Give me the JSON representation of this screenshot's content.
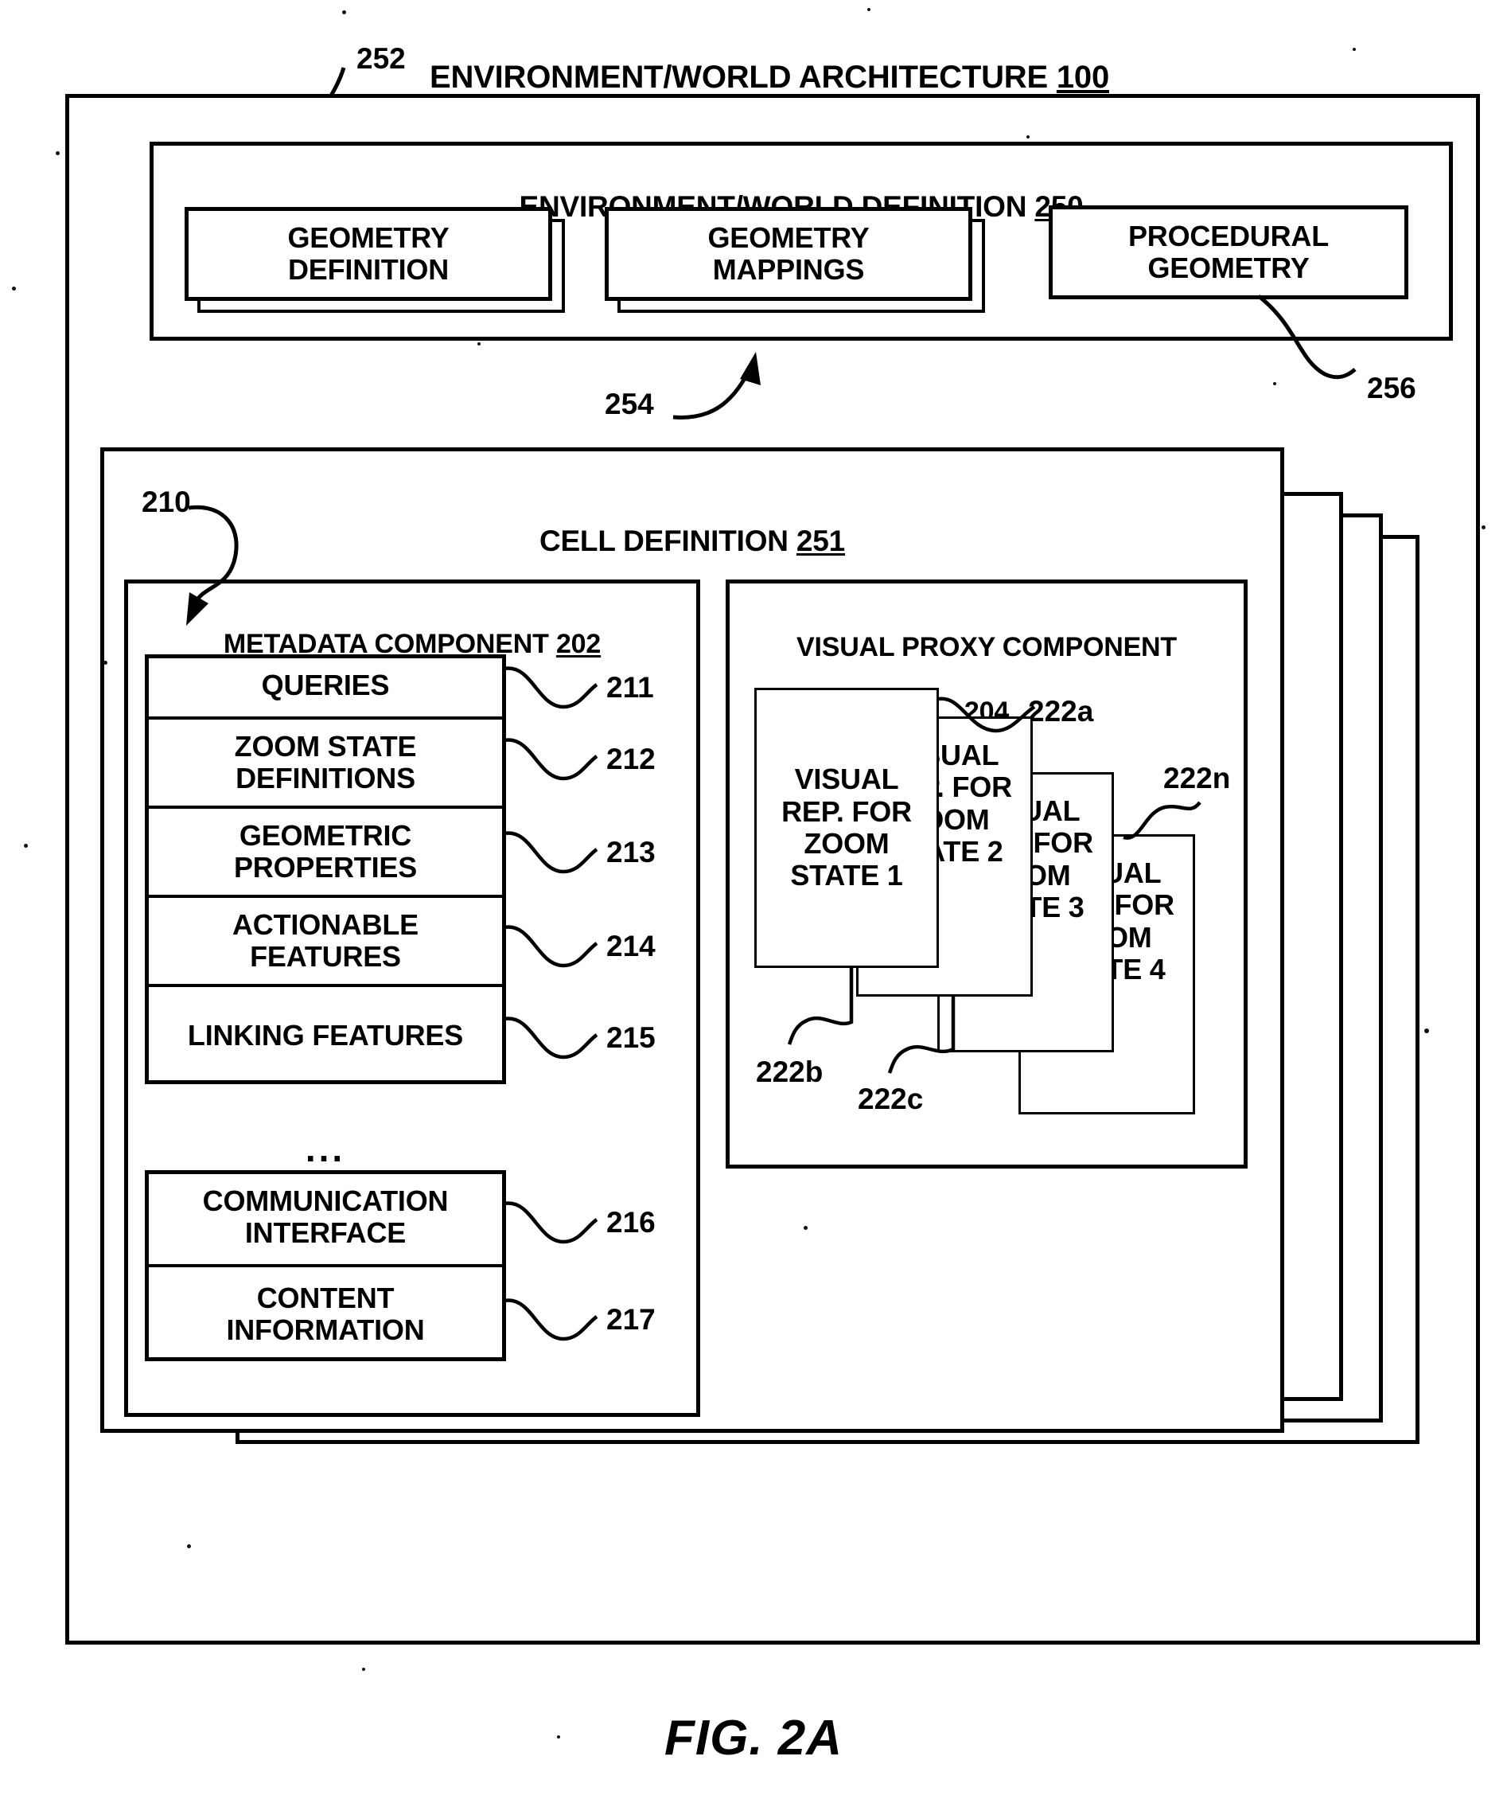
{
  "figure": {
    "caption": "FIG. 2A"
  },
  "architecture": {
    "title": "ENVIRONMENT/WORLD ARCHITECTURE",
    "title_ref": "100",
    "callout_ref": "252"
  },
  "world_definition": {
    "title": "ENVIRONMENT/WORLD DEFINITION",
    "title_ref": "250",
    "boxes": [
      {
        "label": "GEOMETRY\nDEFINITION",
        "stacked": true,
        "ref": ""
      },
      {
        "label": "GEOMETRY\nMAPPINGS",
        "stacked": true,
        "ref": "254"
      },
      {
        "label": "PROCEDURAL\nGEOMETRY",
        "stacked": false,
        "ref": "256"
      }
    ],
    "mappings_ref": "254",
    "procedural_ref": "256"
  },
  "cell_definition": {
    "title": "CELL DEFINITION",
    "title_ref": "251"
  },
  "metadata_component": {
    "title": "METADATA COMPONENT",
    "title_ref": "202",
    "callout_ref": "210",
    "ellipsis": "...",
    "rows": [
      {
        "label": "QUERIES",
        "ref": "211"
      },
      {
        "label": "ZOOM STATE\nDEFINITIONS",
        "ref": "212"
      },
      {
        "label": "GEOMETRIC\nPROPERTIES",
        "ref": "213"
      },
      {
        "label": "ACTIONABLE\nFEATURES",
        "ref": "214"
      },
      {
        "label": "LINKING FEATURES",
        "ref": "215"
      }
    ],
    "rows_lower": [
      {
        "label": "COMMUNICATION\nINTERFACE",
        "ref": "216"
      },
      {
        "label": "CONTENT\nINFORMATION",
        "ref": "217"
      }
    ]
  },
  "visual_proxy_component": {
    "title": "VISUAL PROXY COMPONENT",
    "title_ref": "204",
    "cards": [
      {
        "label": "VISUAL\nREP. FOR\nZOOM\nSTATE 1",
        "ref": "222a"
      },
      {
        "label": "VISUAL\nREP. FOR\nZOOM\nSTATE 2",
        "ref": "222b"
      },
      {
        "label": "VISUAL\nREP. FOR\nZOOM\nSTATE 3",
        "ref": "222c"
      },
      {
        "label": "VISUAL\nREP. FOR\nZOOM\nSTATE 4",
        "ref": "222n"
      }
    ]
  },
  "colors": {
    "ink": "#000000",
    "paper": "#ffffff"
  }
}
